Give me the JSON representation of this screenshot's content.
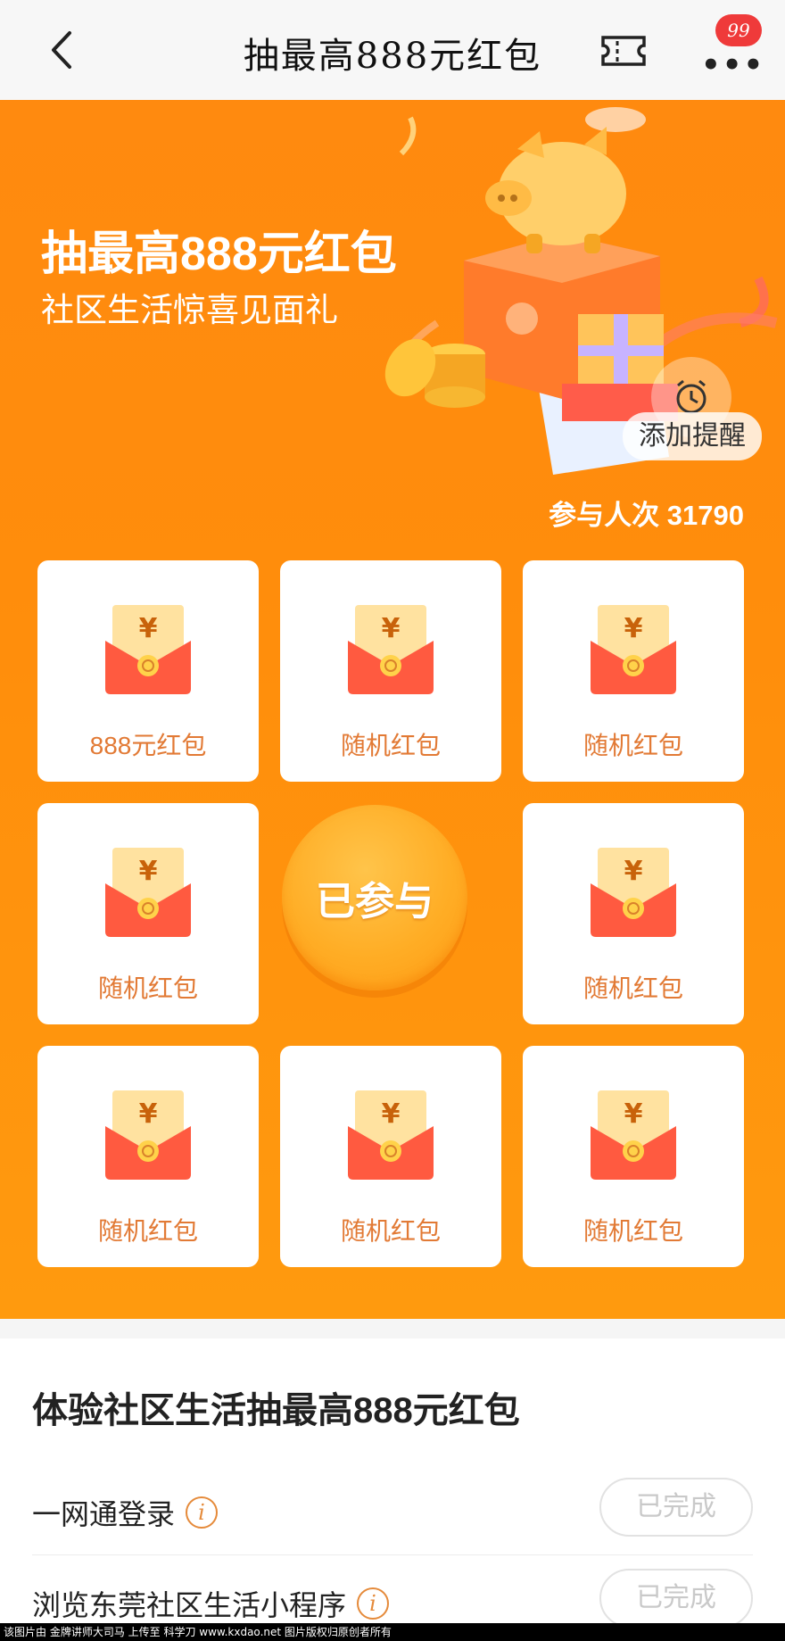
{
  "nav": {
    "title": "抽最高888元红包",
    "badge_count": "99",
    "back_icon": "chevron-left-icon",
    "ticket_icon": "ticket-icon",
    "more_icon": "more-dots-icon"
  },
  "hero": {
    "title": "抽最高888元红包",
    "subtitle": "社区生活惊喜见面礼",
    "reminder_label": "添加提醒",
    "participants_text": "参与人次 31790",
    "participants_count": 31790
  },
  "prizes": {
    "items": [
      {
        "label": "888元红包"
      },
      {
        "label": "随机红包"
      },
      {
        "label": "随机红包"
      },
      {
        "label": "随机红包"
      },
      {
        "label": "随机红包"
      },
      {
        "label": "随机红包"
      },
      {
        "label": "随机红包"
      },
      {
        "label": "随机红包"
      }
    ],
    "center_button_label": "已参与"
  },
  "tasks": {
    "heading": "体验社区生活抽最高888元红包",
    "items": [
      {
        "name": "一网通登录",
        "status": "已完成"
      },
      {
        "name": "浏览东莞社区生活小程序",
        "status": "已完成"
      }
    ]
  },
  "watermark": "该图片由 金牌讲师大司马 上传至 科学刀 www.kxdao.net 图片版权归原创者所有",
  "colors": {
    "hero_orange": "#ff8d0c",
    "card_label": "#e27a35",
    "badge_red": "#ef3a3a",
    "done_gray": "#c9c9c9"
  }
}
